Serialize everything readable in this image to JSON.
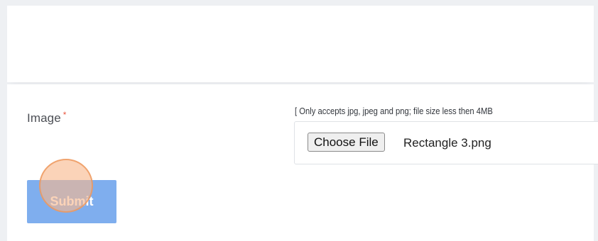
{
  "form": {
    "image_label": "Image",
    "required_marker": "*",
    "hint": "[ Only accepts jpg, jpeg and png; file size less then 4MB",
    "file_input": {
      "button_label": "Choose File",
      "selected_file": "Rectangle 3.png"
    },
    "submit_label": "Submit"
  },
  "colors": {
    "submit_bg": "#7faeee",
    "required_star": "#e9573f",
    "click_indicator": "#f9b88c"
  }
}
